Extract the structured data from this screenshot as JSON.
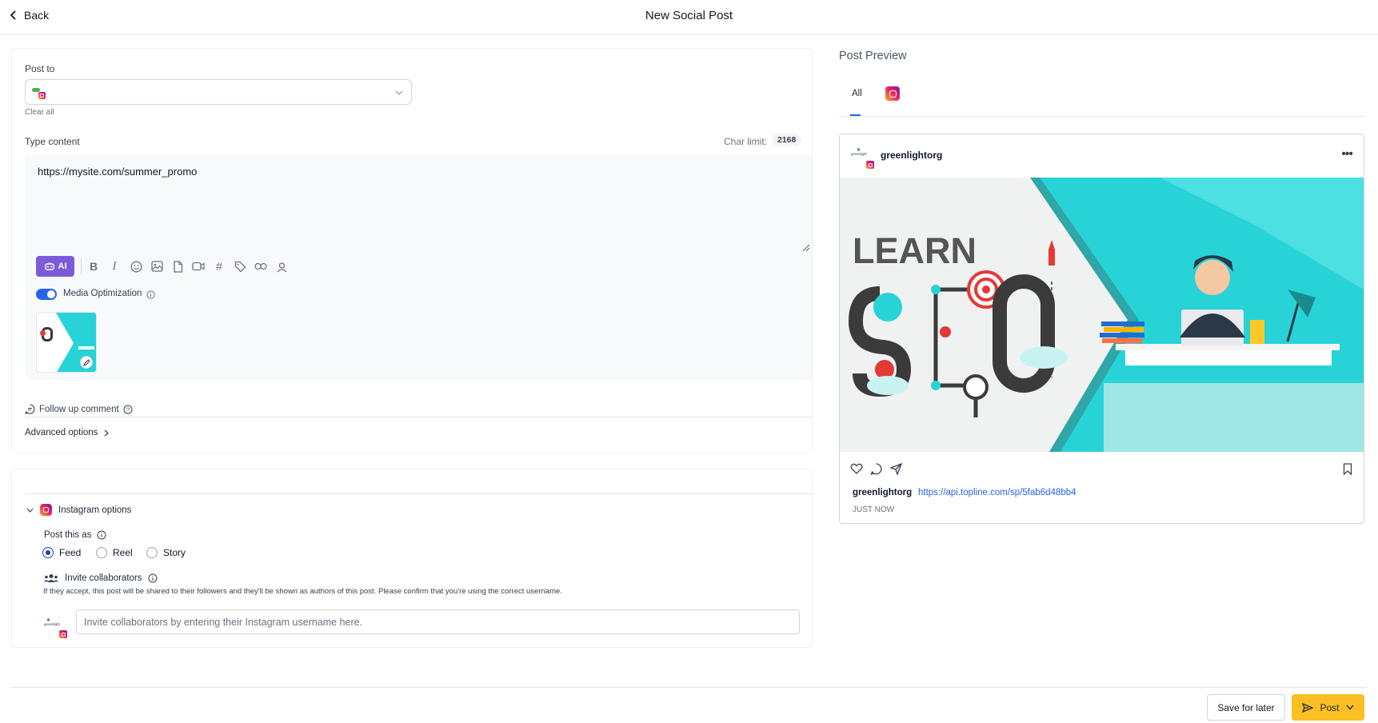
{
  "header": {
    "back_label": "Back",
    "title": "New Social Post"
  },
  "composer": {
    "post_to_label": "Post to",
    "clear_all": "Clear all",
    "type_content_label": "Type content",
    "char_limit_label": "Char limit:",
    "char_limit_value": "2168",
    "content_text": "https://mysite.com/summer_promo",
    "ai_label": "AI",
    "media_optimization_label": "Media Optimization",
    "media_optimization_on": true,
    "follow_up_label": "Follow up comment",
    "advanced_label": "Advanced options"
  },
  "instagram": {
    "section_label": "Instagram options",
    "post_as_label": "Post this as",
    "options": [
      "Feed",
      "Reel",
      "Story"
    ],
    "selected": "Feed",
    "invite_label": "Invite collaborators",
    "invite_description": "If they accept, this post will be shared to their followers and they'll be shown as authors of this post. Please confirm that you're using the correct username.",
    "invite_placeholder": "Invite collaborators by entering their Instagram username here."
  },
  "preview": {
    "title": "Post Preview",
    "tab_all": "All",
    "account_name": "greenlightorg",
    "caption_user": "greenlightorg",
    "caption_link": "https://api.topline.com/sp/5fab6d48bb4",
    "timestamp": "JUST NOW",
    "image_text": "LEARN"
  },
  "footer": {
    "save_later": "Save for later",
    "post": "Post"
  },
  "colors": {
    "primary": "#2563eb",
    "ai": "#7c5bd8",
    "post_button": "#fbbf24",
    "link": "#2563eb",
    "teal": "#27d3d7"
  }
}
